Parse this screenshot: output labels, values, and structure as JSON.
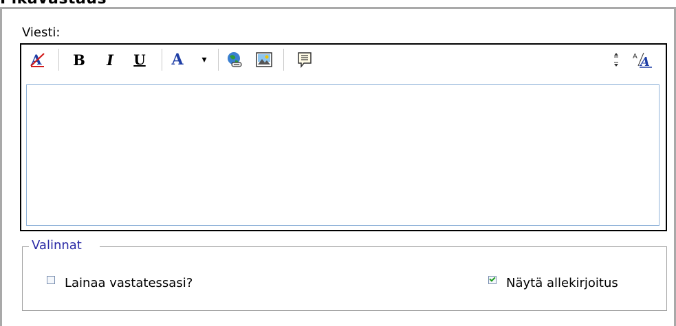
{
  "header": {
    "title": "Pikavastaus"
  },
  "message": {
    "label": "Viesti:",
    "value": ""
  },
  "toolbar": {
    "items": [
      {
        "name": "remove-format",
        "icon": "remove-format-icon"
      },
      {
        "name": "bold",
        "label": "B"
      },
      {
        "name": "italic",
        "label": "I"
      },
      {
        "name": "underline",
        "label": "U"
      },
      {
        "name": "font-color",
        "label": "A",
        "color": "#1f3fa6"
      },
      {
        "name": "font-color-dropdown",
        "label": "▾"
      },
      {
        "name": "insert-link",
        "icon": "globe-link-icon"
      },
      {
        "name": "insert-image",
        "icon": "image-icon"
      },
      {
        "name": "insert-quote",
        "icon": "quote-icon"
      },
      {
        "name": "resize-editor",
        "icon": "resize-arrows-icon"
      },
      {
        "name": "font-size",
        "icon": "font-size-icon"
      }
    ]
  },
  "options": {
    "legend": "Valinnat",
    "quote_reply": {
      "label": "Lainaa vastatessasi?",
      "checked": false
    },
    "show_signature": {
      "label": "Näytä allekirjoitus",
      "checked": true
    }
  }
}
